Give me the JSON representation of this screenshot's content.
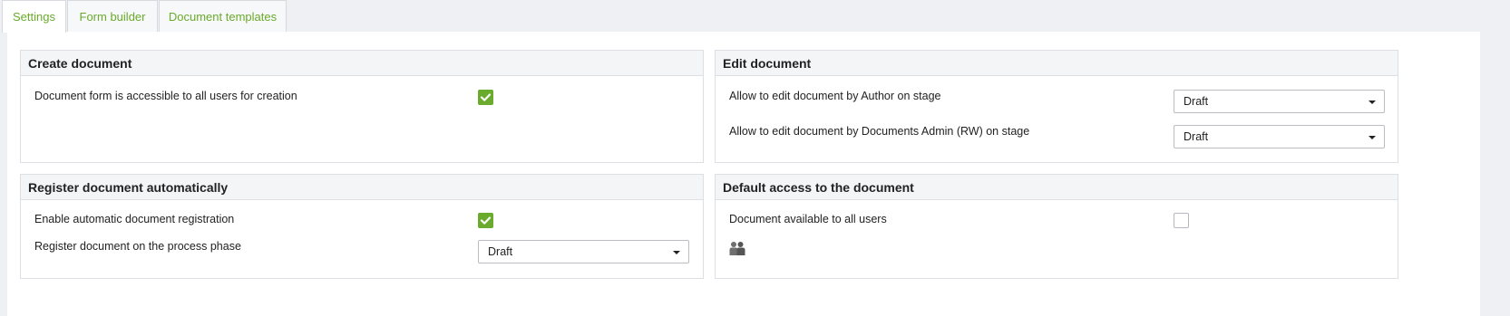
{
  "tabs": [
    {
      "label": "Settings",
      "active": true
    },
    {
      "label": "Form builder",
      "active": false
    },
    {
      "label": "Document templates",
      "active": false
    }
  ],
  "panels": {
    "create": {
      "title": "Create document",
      "rows": [
        {
          "label": "Document form is accessible to all users for creation",
          "checked": true
        }
      ]
    },
    "edit": {
      "title": "Edit document",
      "rows": [
        {
          "label": "Allow to edit document by Author on stage",
          "value": "Draft"
        },
        {
          "label": "Allow to edit document by Documents Admin (RW) on stage",
          "value": "Draft"
        }
      ]
    },
    "register": {
      "title": "Register document automatically",
      "rows": [
        {
          "label": "Enable automatic document registration",
          "checked": true
        },
        {
          "label": "Register document on the process phase",
          "value": "Draft"
        }
      ]
    },
    "access": {
      "title": "Default access to the document",
      "rows": [
        {
          "label": "Document available to all users",
          "checked": false
        }
      ],
      "icon": "users-icon"
    }
  },
  "colors": {
    "accent": "#6aaa2c",
    "background": "#eef0f3",
    "panel_header": "#f4f5f6"
  }
}
